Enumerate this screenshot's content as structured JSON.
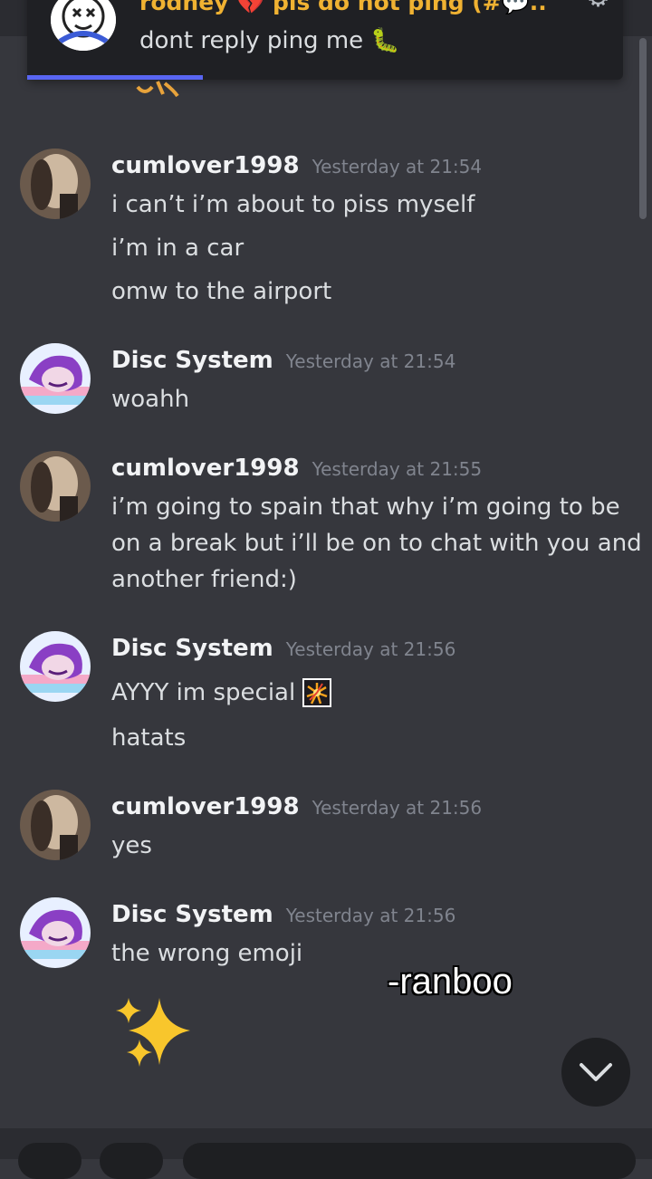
{
  "notification": {
    "title": "rodney 💔 pls do not ping (#💬...",
    "message": "dont reply ping me 🐛"
  },
  "messages": [
    {
      "user": "cumlover1998",
      "time": "Yesterday at 21:54",
      "lines": [
        "i can’t i’m about to piss myself",
        "i’m in a car",
        "omw to the airport"
      ]
    },
    {
      "user": "Disc System",
      "time": "Yesterday at 21:54",
      "lines": [
        "woahh"
      ]
    },
    {
      "user": "cumlover1998",
      "time": "Yesterday at 21:55",
      "lines": [
        "i’m going to spain that why i’m going to be",
        "on a break but i’ll be on to chat with you and",
        "another friend:)"
      ]
    },
    {
      "user": "Disc System",
      "time": "Yesterday at 21:56",
      "lines": [
        "AYYY im special",
        "hatats"
      ]
    },
    {
      "user": "cumlover1998",
      "time": "Yesterday at 21:56",
      "lines": [
        "yes"
      ]
    },
    {
      "user": "Disc System",
      "time": "Yesterday at 21:56",
      "lines": [
        "the wrong emoji"
      ]
    }
  ],
  "sparkles": "✨",
  "watermark": "-ranboo",
  "colors": {
    "background": "#36373d",
    "accent": "#5865f2",
    "username": "#f2f3f5",
    "timestamp": "#80848e"
  }
}
